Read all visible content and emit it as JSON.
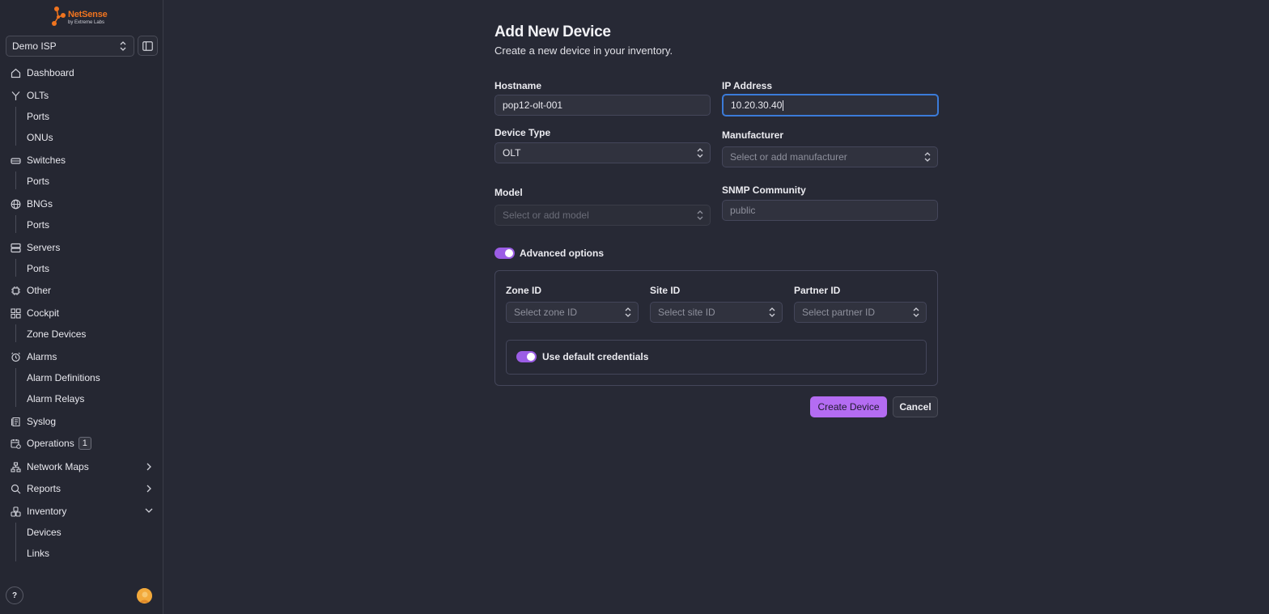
{
  "brand": {
    "name": "NetSense",
    "tagline": "by Extreme Labs"
  },
  "org_select": {
    "value": "Demo ISP"
  },
  "sidebar": {
    "items": [
      {
        "label": "Dashboard"
      },
      {
        "label": "OLTs",
        "children": [
          "Ports",
          "ONUs"
        ]
      },
      {
        "label": "Switches",
        "children": [
          "Ports"
        ]
      },
      {
        "label": "BNGs",
        "children": [
          "Ports"
        ]
      },
      {
        "label": "Servers",
        "children": [
          "Ports"
        ]
      },
      {
        "label": "Other"
      },
      {
        "label": "Cockpit",
        "children": [
          "Zone Devices"
        ]
      },
      {
        "label": "Alarms",
        "children": [
          "Alarm Definitions",
          "Alarm Relays"
        ]
      },
      {
        "label": "Syslog"
      },
      {
        "label": "Operations",
        "badge": "1"
      },
      {
        "label": "Network Maps"
      },
      {
        "label": "Reports"
      },
      {
        "label": "Inventory",
        "children": [
          "Devices",
          "Links"
        ]
      }
    ]
  },
  "help": {
    "label": "?"
  },
  "form": {
    "title": "Add New Device",
    "subtitle": "Create a new device in your inventory.",
    "hostname": {
      "label": "Hostname",
      "value": "pop12-olt-001"
    },
    "ip_address": {
      "label": "IP Address",
      "value": "10.20.30.40"
    },
    "device_type": {
      "label": "Device Type",
      "value": "OLT"
    },
    "manufacturer": {
      "label": "Manufacturer",
      "placeholder": "Select or add manufacturer"
    },
    "model": {
      "label": "Model",
      "placeholder": "Select or add model"
    },
    "snmp": {
      "label": "SNMP Community",
      "placeholder": "public"
    },
    "advanced_toggle": {
      "label": "Advanced options",
      "on": true
    },
    "zone_id": {
      "label": "Zone ID",
      "placeholder": "Select zone ID"
    },
    "site_id": {
      "label": "Site ID",
      "placeholder": "Select site ID"
    },
    "partner_id": {
      "label": "Partner ID",
      "placeholder": "Select partner ID"
    },
    "default_creds": {
      "label": "Use default credentials",
      "on": true
    },
    "create_label": "Create Device",
    "cancel_label": "Cancel"
  },
  "colors": {
    "accent": "#b46cf2",
    "toggle": "#9b5de5",
    "focus": "#3b7bd9",
    "brand": "#f0741f"
  }
}
